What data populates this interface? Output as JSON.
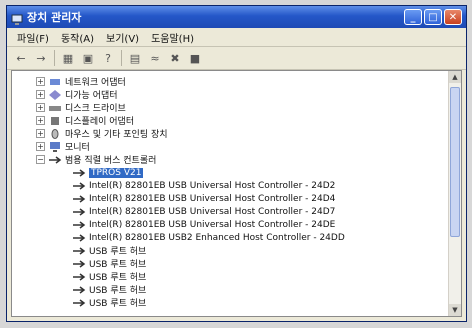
{
  "window": {
    "title": "장치 관리자",
    "icon": "computer-management-icon",
    "controls": [
      "minimize-icon",
      "maximize-icon",
      "close-icon"
    ]
  },
  "menu": {
    "items": [
      "파일(F)",
      "동작(A)",
      "보기(V)",
      "도움말(H)"
    ]
  },
  "toolbar": {
    "icons": [
      "back-icon",
      "forward-icon",
      "properties-icon",
      "scan-hardware-icon",
      "help-icon",
      "update-driver-icon",
      "disable-icon",
      "uninstall-icon"
    ]
  },
  "tree": {
    "categories": [
      {
        "label": "네트워크 어댑터",
        "icon": "network-adapter-icon",
        "expanded": false
      },
      {
        "label": "디가능 어댑터",
        "icon": "adapter-icon",
        "expanded": false
      },
      {
        "label": "디스크 드라이브",
        "icon": "disk-drive-icon",
        "expanded": false
      },
      {
        "label": "디스플레이 어댑터",
        "icon": "display-adapter-icon",
        "expanded": false
      },
      {
        "label": "마우스 및 기타 포인팅 장치",
        "icon": "mouse-icon",
        "expanded": false
      },
      {
        "label": "모니터",
        "icon": "monitor-icon",
        "expanded": false
      },
      {
        "label": "범용 직렬 버스 컨트롤러",
        "icon": "usb-icon",
        "expanded": true
      }
    ],
    "usb_children": [
      {
        "label": "TPROS V21",
        "selected": true
      },
      {
        "label": "Intel(R) 82801EB USB Universal Host Controller - 24D2",
        "selected": false
      },
      {
        "label": "Intel(R) 82801EB USB Universal Host Controller - 24D4",
        "selected": false
      },
      {
        "label": "Intel(R) 82801EB USB Universal Host Controller - 24D7",
        "selected": false
      },
      {
        "label": "Intel(R) 82801EB USB Universal Host Controller - 24DE",
        "selected": false
      },
      {
        "label": "Intel(R) 82801EB USB2 Enhanced Host Controller - 24DD",
        "selected": false
      },
      {
        "label": "USB 루트 허브",
        "selected": false
      },
      {
        "label": "USB 루트 허브",
        "selected": false
      },
      {
        "label": "USB 루트 허브",
        "selected": false
      },
      {
        "label": "USB 루트 허브",
        "selected": false
      },
      {
        "label": "USB 루트 허브",
        "selected": false
      }
    ]
  },
  "colors": {
    "titlebar": "#2457c8",
    "selection": "#316ac5",
    "window_bg": "#ece9d8"
  }
}
